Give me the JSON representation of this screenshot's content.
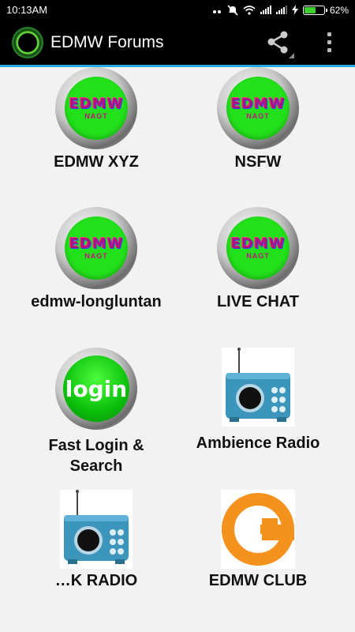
{
  "status_bar": {
    "time": "10:13AM",
    "battery_percent": "62%",
    "battery_level": 0.62
  },
  "app_bar": {
    "title": "EDMW Forums",
    "share_icon": "share-icon",
    "menu_icon": "overflow-menu-icon"
  },
  "badge": {
    "edmw_text": "EDMW",
    "nagt_text": "NAGT",
    "login_text": "login"
  },
  "tiles": [
    {
      "label": "EDMW XYZ",
      "icon": "edmw-badge-icon"
    },
    {
      "label": "NSFW",
      "icon": "edmw-badge-icon"
    },
    {
      "label": "edmw-longluntan",
      "icon": "edmw-badge-icon"
    },
    {
      "label": "LIVE CHAT",
      "icon": "edmw-badge-icon"
    },
    {
      "label": "Fast Login & Search",
      "icon": "login-icon"
    },
    {
      "label": "Ambience Radio",
      "icon": "radio-icon"
    },
    {
      "label": "…K RADIO",
      "icon": "radio-icon"
    },
    {
      "label": "EDMW CLUB",
      "icon": "power-ring-icon"
    }
  ],
  "colors": {
    "app_bar_bg": "#000000",
    "accent_line": "#29a9e0",
    "badge_green": "#22e01a",
    "badge_text": "#b1127a",
    "radio_blue": "#3c95bb",
    "ring_orange": "#f5921e",
    "battery_green": "#3ecf2f"
  }
}
